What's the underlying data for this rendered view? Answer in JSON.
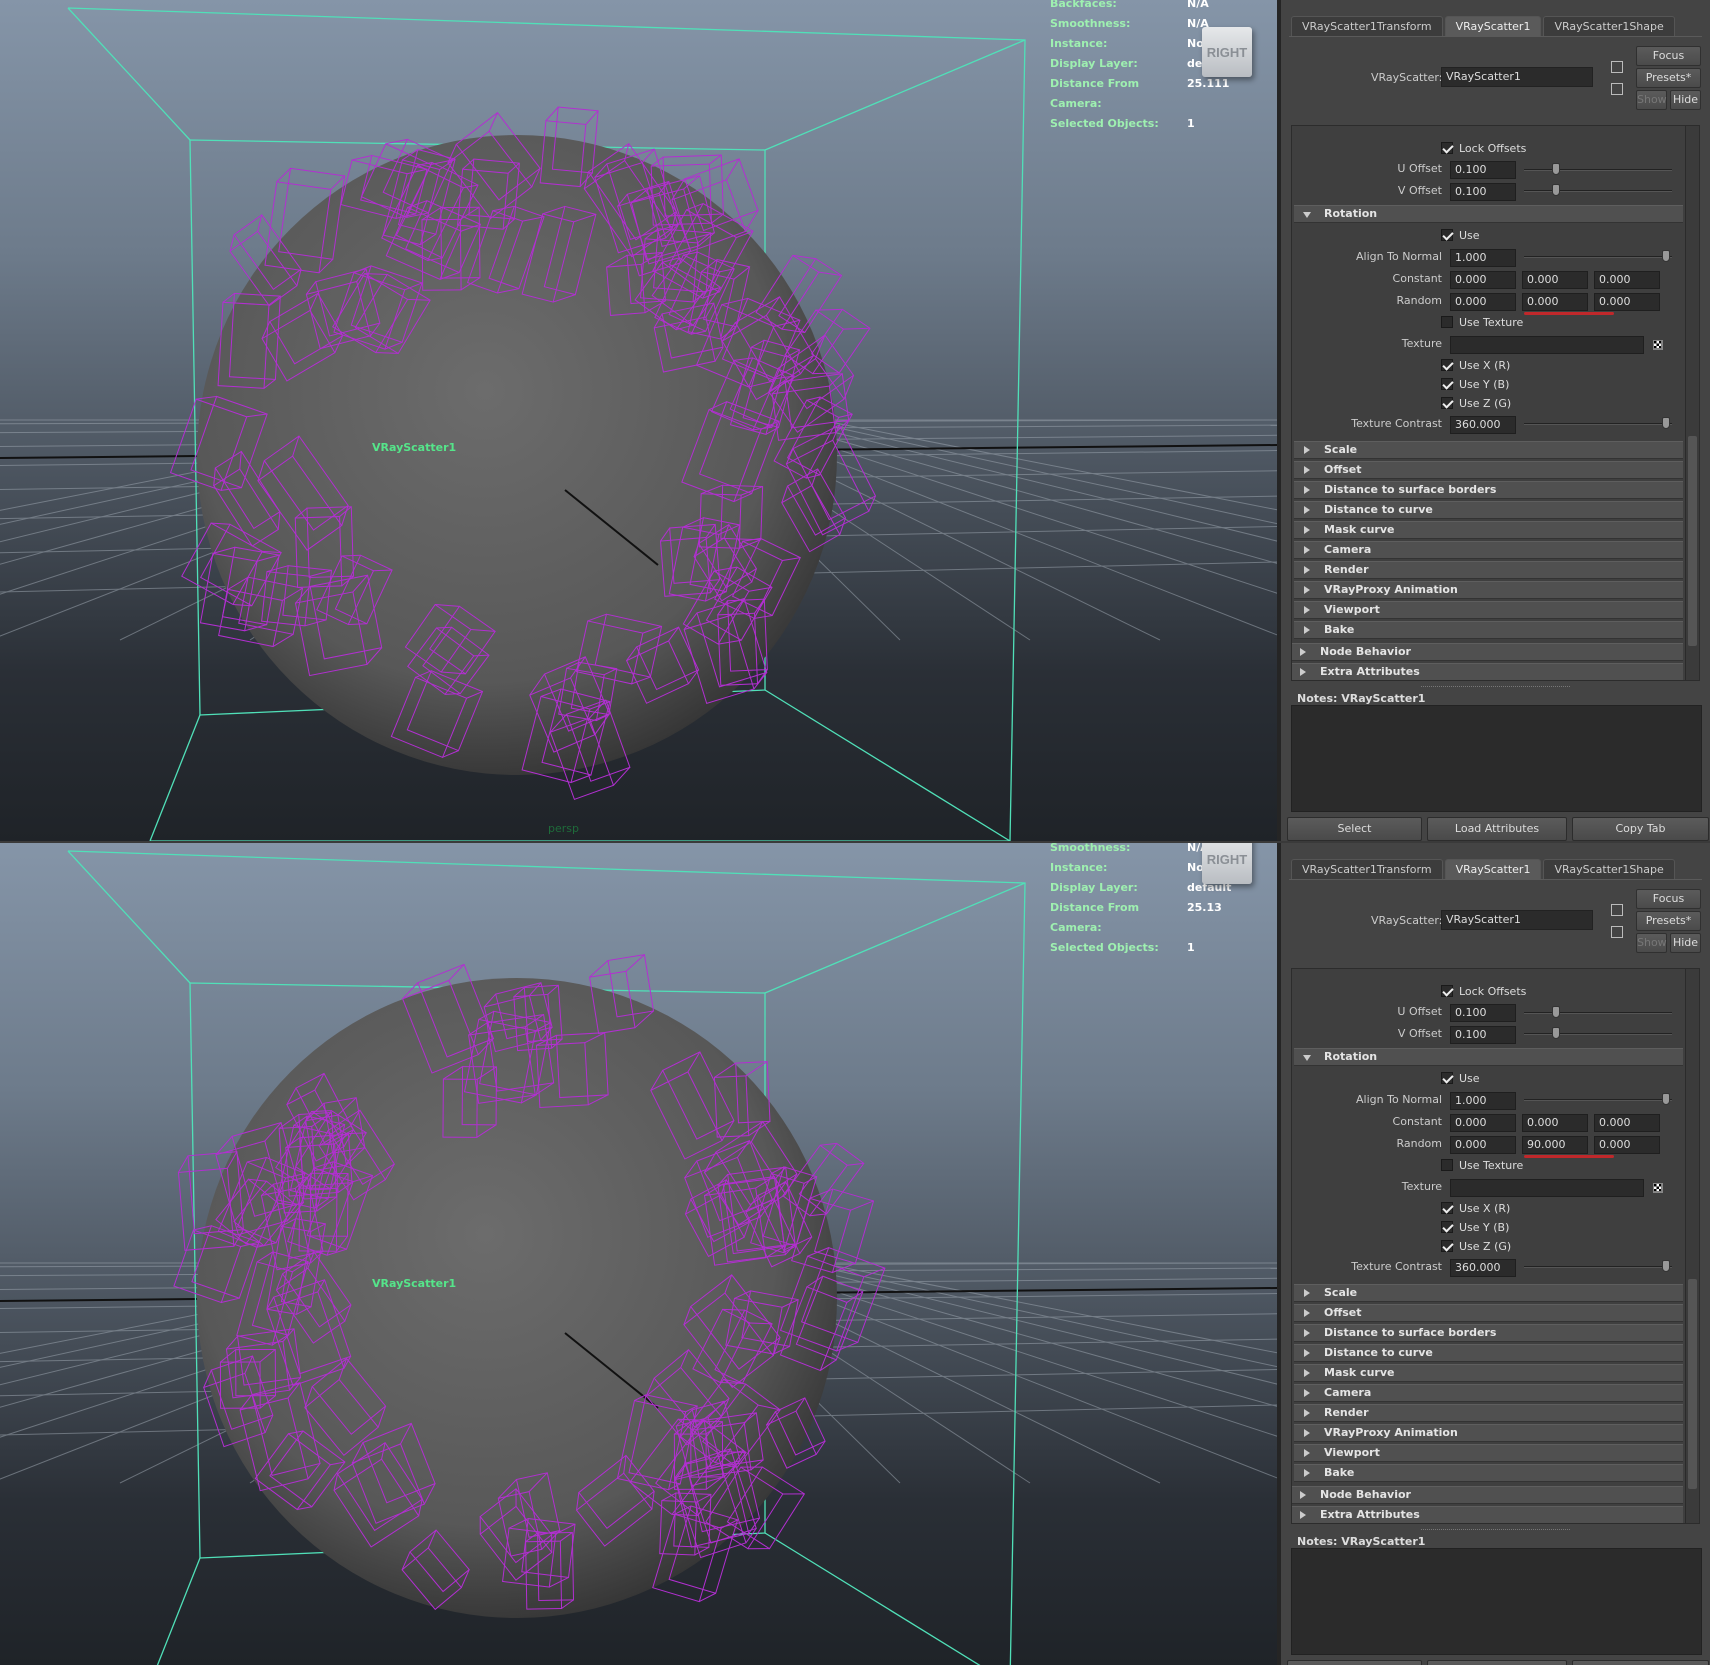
{
  "top": {
    "hud": [
      {
        "k": "Backfaces:",
        "v": "N/A"
      },
      {
        "k": "Smoothness:",
        "v": "N/A"
      },
      {
        "k": "Instance:",
        "v": "No"
      },
      {
        "k": "Display Layer:",
        "v": "default"
      },
      {
        "k": "Distance From Camera:",
        "v": "25.111"
      },
      {
        "k": "Selected Objects:",
        "v": "1"
      }
    ],
    "nav_cube": "RIGHT",
    "object_label": "VRayScatter1",
    "camera_label": "persp",
    "random": [
      "0.000",
      "0.000",
      "0.000"
    ]
  },
  "bottom": {
    "hud": [
      {
        "k": "Smoothness:",
        "v": "N/A"
      },
      {
        "k": "Instance:",
        "v": "No"
      },
      {
        "k": "Display Layer:",
        "v": "default"
      },
      {
        "k": "Distance From Camera:",
        "v": "25.13"
      },
      {
        "k": "Selected Objects:",
        "v": "1"
      }
    ],
    "nav_cube": "RIGHT",
    "object_label": "VRayScatter1",
    "random": [
      "0.000",
      "90.000",
      "0.000"
    ]
  },
  "panel": {
    "tabs": [
      "VRayScatter1Transform",
      "VRayScatter1",
      "VRayScatter1Shape"
    ],
    "node_label": "VRayScatter:",
    "node_value": "VRayScatter1",
    "focus": "Focus",
    "presets": "Presets*",
    "show": "Show",
    "hide": "Hide",
    "lock_offsets": "Lock Offsets",
    "u_offset_label": "U Offset",
    "u_offset": "0.100",
    "v_offset_label": "V Offset",
    "v_offset": "0.100",
    "rotation": "Rotation",
    "use": "Use",
    "align_label": "Align To Normal",
    "align": "1.000",
    "constant_label": "Constant",
    "constant": [
      "0.000",
      "0.000",
      "0.000"
    ],
    "random_label": "Random",
    "use_texture": "Use Texture",
    "texture_label": "Texture",
    "use_x": "Use X (R)",
    "use_y": "Use Y (B)",
    "use_z": "Use Z (G)",
    "tex_contrast_label": "Texture Contrast",
    "tex_contrast": "360.000",
    "sections": [
      "Scale",
      "Offset",
      "Distance to surface borders",
      "Distance to curve",
      "Mask curve",
      "Camera",
      "Render",
      "VRayProxy Animation",
      "Viewport",
      "Bake"
    ],
    "node_behavior": "Node Behavior",
    "extra_attributes": "Extra Attributes",
    "notes": "Notes:  VRayScatter1",
    "select": "Select",
    "load_attributes": "Load Attributes",
    "copy_tab": "Copy Tab"
  }
}
